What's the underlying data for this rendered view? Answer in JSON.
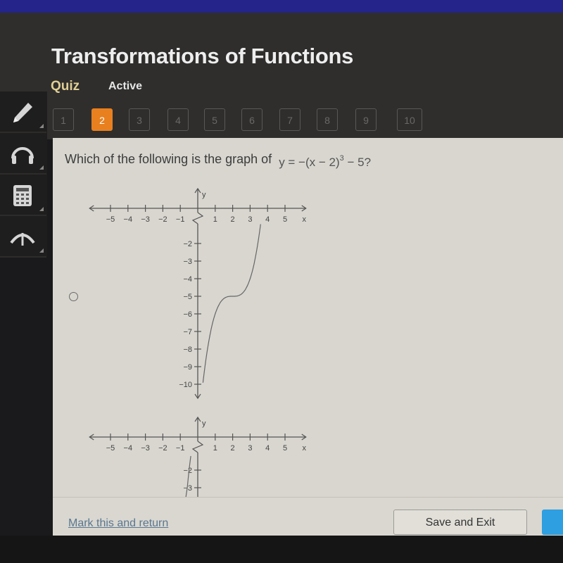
{
  "header": {
    "title": "Transformations of Functions",
    "tabs": [
      {
        "label": "Quiz"
      },
      {
        "label": "Active"
      }
    ]
  },
  "question_nav": {
    "current": 2,
    "items": [
      "1",
      "2",
      "3",
      "4",
      "5",
      "6",
      "7",
      "8",
      "9",
      "10"
    ],
    "accent_color": "#e8801f"
  },
  "sidebar": {
    "tools": [
      {
        "icon": "pencil-icon"
      },
      {
        "icon": "headphones-icon"
      },
      {
        "icon": "calculator-icon"
      },
      {
        "icon": "collapse-arrow-icon"
      }
    ]
  },
  "question": {
    "text": "Which of the following is the graph of",
    "equation_prefix": "y = −(x − 2)",
    "equation_exponent": "3",
    "equation_suffix": " − 5?"
  },
  "options": [
    {
      "selected": false,
      "graph": {
        "x_ticks": [
          "−5",
          "−4",
          "−3",
          "−2",
          "−1",
          "1",
          "2",
          "3",
          "4",
          "5"
        ],
        "y_ticks": [
          "−2",
          "−3",
          "−4",
          "−5",
          "−6",
          "−7",
          "−8",
          "−9",
          "−10"
        ],
        "x_label": "x",
        "y_label": "y",
        "curve": "y=(x-2)^3-5",
        "curve_points": [
          [
            0.3,
            -9.9
          ],
          [
            0.7,
            -7.2
          ],
          [
            1,
            -6
          ],
          [
            1.5,
            -5.13
          ],
          [
            2,
            -5
          ],
          [
            2.5,
            -4.87
          ],
          [
            3,
            -4
          ],
          [
            3.3,
            -2.8
          ],
          [
            3.6,
            -1.0
          ]
        ]
      }
    },
    {
      "selected": false,
      "graph": {
        "x_ticks": [
          "−5",
          "−4",
          "−3",
          "−2",
          "−1",
          "1",
          "2",
          "3",
          "4",
          "5"
        ],
        "y_ticks": [
          "−2",
          "−3"
        ],
        "x_label": "x",
        "y_label": "y",
        "curve_points": [
          [
            -0.4,
            -1.2
          ],
          [
            -0.5,
            -2
          ],
          [
            -0.6,
            -3
          ],
          [
            -0.75,
            -4
          ]
        ]
      }
    }
  ],
  "footer": {
    "mark_link": "Mark this and return",
    "save_label": "Save and Exit"
  }
}
